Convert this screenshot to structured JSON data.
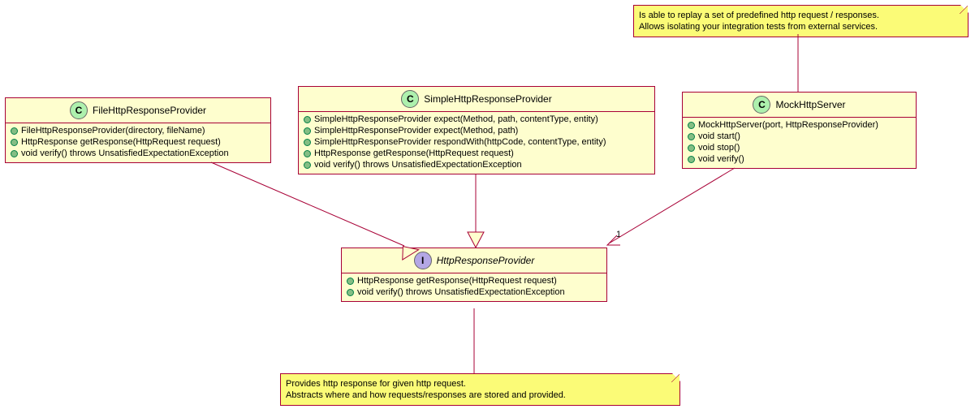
{
  "notes": {
    "mock_server_note": {
      "line1": "Is able to replay a set of predefined http request / responses.",
      "line2": "Allows isolating your integration tests from external services."
    },
    "provider_note": {
      "line1": "Provides http response for given http request.",
      "line2": "Abstracts where and how requests/responses are stored and provided."
    }
  },
  "classes": {
    "file_provider": {
      "name": "FileHttpResponseProvider",
      "members": [
        "FileHttpResponseProvider(directory, fileName)",
        "HttpResponse getResponse(HttpRequest request)",
        "void verify() throws UnsatisfiedExpectationException"
      ]
    },
    "simple_provider": {
      "name": "SimpleHttpResponseProvider",
      "members": [
        "SimpleHttpResponseProvider expect(Method, path, contentType, entity)",
        "SimpleHttpResponseProvider expect(Method, path)",
        "SimpleHttpResponseProvider respondWith(httpCode, contentType, entity)",
        "HttpResponse getResponse(HttpRequest request)",
        "void verify() throws UnsatisfiedExpectationException"
      ]
    },
    "mock_server": {
      "name": "MockHttpServer",
      "members": [
        "MockHttpServer(port, HttpResponseProvider)",
        "void start()",
        "void stop()",
        "void verify()"
      ]
    },
    "provider_interface": {
      "name": "HttpResponseProvider",
      "members": [
        "HttpResponse getResponse(HttpRequest request)",
        "void verify() throws UnsatisfiedExpectationException"
      ]
    }
  },
  "cardinality": {
    "mock_to_provider": "1"
  }
}
